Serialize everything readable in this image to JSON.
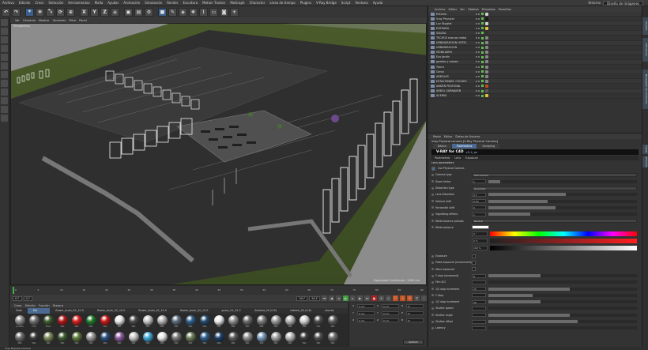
{
  "menubar": {
    "items": [
      "Archivo",
      "Edición",
      "Crear",
      "Selección",
      "Herramientas",
      "Malla",
      "Ayudar",
      "Animación",
      "Simulación",
      "Render",
      "Escultura",
      "Motion Tracker",
      "MoGraph",
      "Character",
      "Línea de tiempo",
      "Plugins",
      "V-Ray Bridge",
      "Script",
      "Ventana",
      "Ayuda"
    ],
    "layout_label": "Entorno",
    "layout_value": "Diseño de Imágenes"
  },
  "toolbar": {
    "axis_x": "X",
    "axis_y": "Y",
    "axis_z": "Z"
  },
  "viewport": {
    "menu": [
      "Ver",
      "Cámaras",
      "Mostrar",
      "Opciones",
      "Filtro",
      "Panel"
    ],
    "label": "Perspectiva",
    "status": "Espaciado Cuadrícula : 1000 cm"
  },
  "timeline": {
    "frame_start": "0 F",
    "frame_current": "0 F",
    "frame_end": "90 F",
    "frame_end2": "90 F",
    "ticks": [
      "0",
      "5",
      "10",
      "15",
      "20",
      "25",
      "30",
      "35",
      "40",
      "45",
      "50",
      "55",
      "60",
      "65",
      "70",
      "75",
      "80",
      "85",
      "90"
    ]
  },
  "materials": {
    "menu": [
      "Crear",
      "Edición",
      "Función",
      "Textura"
    ],
    "tabs": [
      "Todo",
      "Sin Capa",
      "flower_bush_02_10.0 m",
      "flower_bush_02_10.0 m",
      "flower_bush_02_10.0 m",
      "flower_bush_02_10.0 m",
      "grass_01_01.2 m",
      "Seeded_04 (0.8) m",
      "sidewa_04 (0.8) m",
      "stones 10_01"
    ],
    "active_tab": 1,
    "row1": [
      {
        "name": "prueba",
        "color": "#8a8a8a"
      },
      {
        "name": "mat",
        "color": "#6f6f6f"
      },
      {
        "name": "Plant",
        "color": "#3f5a2e"
      },
      {
        "name": "Mat",
        "color": "#b01818"
      },
      {
        "name": "Mat",
        "color": "#d61d1d"
      },
      {
        "name": "Mat",
        "color": "#1f7a2a"
      },
      {
        "name": "Mat",
        "color": "#c91616"
      },
      {
        "name": "Mat",
        "color": "#e8e8e8"
      },
      {
        "name": "Mat",
        "color": "#4a4a4a"
      },
      {
        "name": "Mat",
        "color": "#c7c7c7"
      },
      {
        "name": "Mat",
        "color": "#b5b5b5"
      },
      {
        "name": "Mat",
        "color": "#5c6b7a"
      },
      {
        "name": "Mat",
        "color": "#2f5f8a"
      },
      {
        "name": "Mat",
        "color": "#244b6e"
      },
      {
        "name": "Mat",
        "color": "#ebebeb"
      },
      {
        "name": "Mat",
        "color": "#8f8f8f"
      },
      {
        "name": "Mat",
        "color": "#6b6b6b"
      },
      {
        "name": "Mat",
        "color": "#7d7d7d"
      },
      {
        "name": "Mat",
        "color": "#9b9b9b"
      },
      {
        "name": "Mat",
        "color": "#b3b3b3"
      },
      {
        "name": "Mat",
        "color": "#d3d3d3"
      },
      {
        "name": "Mat",
        "color": "#4b4b4b"
      },
      {
        "name": "Mat",
        "color": "#5a5a5a"
      },
      {
        "name": "Mat",
        "color": "#6a6a6a"
      },
      {
        "name": "Mat",
        "color": "#3a3a3a"
      }
    ],
    "row2": [
      {
        "name": "Mat",
        "color": "#7b8a5a"
      },
      {
        "name": "Mat",
        "color": "#3e5a30"
      },
      {
        "name": "Mat",
        "color": "#5d7a3a"
      },
      {
        "name": "Mat",
        "color": "#9a9a9a"
      },
      {
        "name": "Mat",
        "color": "#2a4f7c"
      },
      {
        "name": "Mat",
        "color": "#8a5a9c"
      },
      {
        "name": "Mat",
        "color": "#c7c7c7"
      },
      {
        "name": "Mat",
        "color": "#3fa6d6"
      },
      {
        "name": "Mat",
        "color": "#e7e7e7"
      },
      {
        "name": "Mat",
        "color": "#777777"
      },
      {
        "name": "Mat",
        "color": "#6b7d5a"
      },
      {
        "name": "Mat",
        "color": "#2f5f8a"
      },
      {
        "name": "Mat",
        "color": "#1c3f66"
      },
      {
        "name": "Mat",
        "color": "#5a5a5a"
      },
      {
        "name": "Mat",
        "color": "#8c8c8c"
      },
      {
        "name": "Mat",
        "color": "#7a9aba"
      },
      {
        "name": "Mat",
        "color": "#a0a0a0"
      },
      {
        "name": "Mat",
        "color": "#b8b8b8"
      },
      {
        "name": "Mat",
        "color": "#3b3b3b"
      },
      {
        "name": "Mat",
        "color": "#4c4c4c"
      },
      {
        "name": "Mat",
        "color": "#6e6e6e"
      },
      {
        "name": "Mat",
        "color": "#d9d9d9"
      },
      {
        "name": "Mat",
        "color": "#2b2b2b"
      },
      {
        "name": "Mat",
        "color": "#5e5e5e"
      },
      {
        "name": "Mat",
        "color": "#8b8b8b"
      }
    ]
  },
  "coords": {
    "rows": [
      [
        "X",
        "0 cm",
        "X",
        "0 cm",
        "H",
        "0°"
      ],
      [
        "Y",
        "0 cm",
        "Y",
        "0 cm",
        "P",
        "0°"
      ],
      [
        "Z",
        "0 cm",
        "Z",
        "0 cm",
        "B",
        "0°"
      ]
    ],
    "apply": "Aplicar"
  },
  "objects": {
    "menu": [
      "Archivo",
      "Editar",
      "Ver",
      "Objetos",
      "Etiquetas",
      "Favoritos"
    ],
    "items": [
      {
        "name": "Entorno",
        "tag": "#cfcfcf"
      },
      {
        "name": "Vray Physical",
        "tag": "#1a1a1a"
      },
      {
        "name": "Luz Skygird",
        "tag": "#cfcfcf"
      },
      {
        "name": "ENTRADA",
        "tag": "#e2c23b"
      },
      {
        "name": "SALIDA",
        "tag": "#333"
      },
      {
        "name": "TECHOS marcos metal",
        "tag": "#888"
      },
      {
        "name": "URBANIZACION HOTEL",
        "tag": "#888"
      },
      {
        "name": "URBANIZACION",
        "tag": "#888"
      },
      {
        "name": "MOBILIARIO",
        "tag": "#888"
      },
      {
        "name": "Eco Jardin",
        "tag": "#888"
      },
      {
        "name": "gazebo y mesas",
        "tag": "#888"
      },
      {
        "name": "Tierra",
        "tag": "#888"
      },
      {
        "name": "Cerco",
        "tag": "#888"
      },
      {
        "name": "ARBOLES",
        "tag": "#888"
      },
      {
        "name": "ESTACIONAM. COCHES",
        "tag": "#888"
      },
      {
        "name": "ANDEN PEATONAL",
        "tag": "#c6481e"
      },
      {
        "name": "ARBOL SARNAKEN",
        "tag": "#5a5a5a"
      },
      {
        "name": "ACERAS",
        "tag": "#e2c23b"
      }
    ]
  },
  "attributes": {
    "menu": [
      "Modo",
      "Editar",
      "Datos de Usuario"
    ],
    "title": "Vray Physical camera [V-Ray Physical Camera]",
    "tabs": [
      "Básico",
      "Parámetros",
      "Sampling"
    ],
    "active_tab": 1,
    "vray_name": "V-RAY for C4D",
    "vray_version": "v3.4_av",
    "param_bar": [
      "Parámetros",
      "Lens",
      "Exposure"
    ],
    "lens_section": "Lens parameters",
    "use_phys": "Use Physical Camera",
    "rows": [
      {
        "label": "Camera type",
        "kind": "drop",
        "val": "",
        "drop": "Still camera"
      },
      {
        "label": "Zoom factor",
        "kind": "bar",
        "val": "1",
        "fill": 0.08
      },
      {
        "label": "Distortion type",
        "kind": "drop",
        "val": "",
        "drop": "Quadratic"
      },
      {
        "label": "Lens Distortion",
        "kind": "bar",
        "val": "0.7",
        "fill": 0.52
      },
      {
        "label": "Vertical shift",
        "kind": "bar",
        "val": "0.03",
        "fill": 0.4
      },
      {
        "label": "Horizontal shift",
        "kind": "bar",
        "val": "0",
        "fill": 0.45
      },
      {
        "label": "Vignetting effects",
        "kind": "bar",
        "val": "1",
        "fill": 0.28
      },
      {
        "label": "White balance presets",
        "kind": "drop",
        "val": "",
        "drop": "Neutral"
      },
      {
        "label": "White balance",
        "kind": "swatch",
        "val": "",
        "drop": ""
      }
    ],
    "color_nums": [
      "0 °",
      "0 %",
      "100 %"
    ],
    "rows2": [
      {
        "label": "Exposure",
        "kind": "check",
        "val": "",
        "fill": 0
      },
      {
        "label": "Fixed exposure (recommend)",
        "kind": "check",
        "val": "",
        "fill": 0
      },
      {
        "label": "Store exposure",
        "kind": "check",
        "val": "",
        "fill": 0
      },
      {
        "label": "F-stop (recomend)",
        "kind": "bar",
        "val": "8",
        "fill": 0.35
      },
      {
        "label": "Film ISO",
        "kind": "bar",
        "val": "",
        "fill": 0
      },
      {
        "label": "1/2 stop increment",
        "kind": "bar",
        "val": "15",
        "fill": 0.55
      },
      {
        "label": "F-Stop",
        "kind": "bar",
        "val": "",
        "fill": 0.3
      },
      {
        "label": "1/2 stop increment",
        "kind": "bar",
        "val": "40",
        "fill": 0.35
      },
      {
        "label": "Shutter speed",
        "kind": "bar",
        "val": "",
        "fill": 0
      },
      {
        "label": "Shutter angle",
        "kind": "bar",
        "val": "",
        "fill": 0.55
      },
      {
        "label": "Shutter offset",
        "kind": "bar",
        "val": "",
        "fill": 0.6
      },
      {
        "label": "Latency",
        "kind": "bar",
        "val": "",
        "fill": 0
      }
    ]
  },
  "right_strip": [
    "Objetos",
    "Estructura",
    "Navegador de Contenido",
    "Capas",
    "Atributos"
  ],
  "status": "Vray Physical Camera"
}
